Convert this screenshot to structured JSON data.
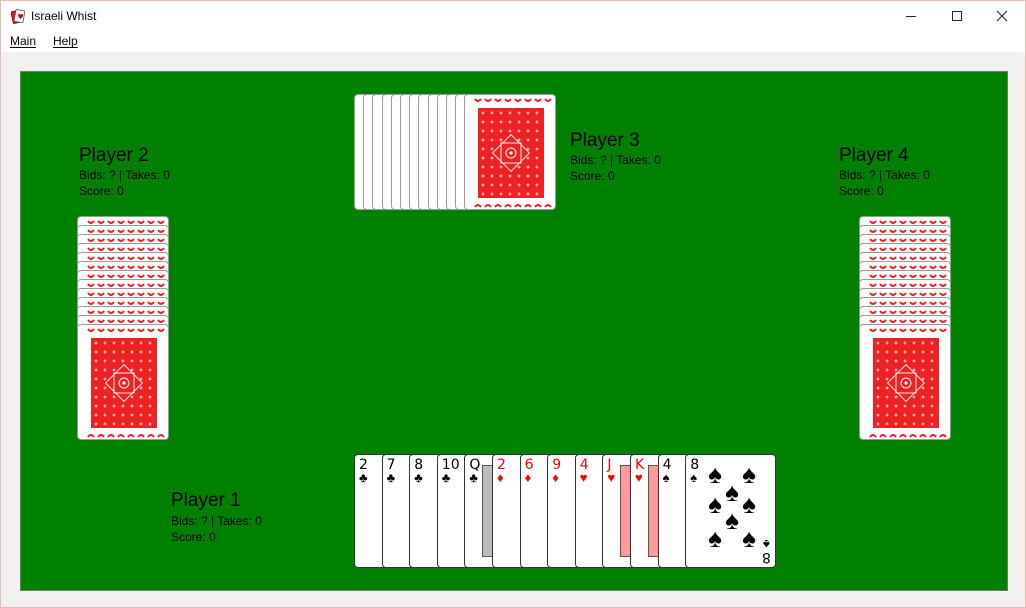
{
  "window": {
    "title": "Israeli Whist",
    "icons": {
      "app": "cards-app-icon",
      "minimize": "minimize-icon",
      "maximize": "maximize-icon",
      "close": "close-icon"
    }
  },
  "menu": {
    "main": "Main",
    "help": "Help"
  },
  "colors": {
    "table": "#008000",
    "card_back": "#ee2222",
    "red_suit": "#ff0000"
  },
  "players": {
    "p1": {
      "name": "Player 1",
      "bids_takes": "Bids: ? | Takes: 0",
      "score": "Score: 0"
    },
    "p2": {
      "name": "Player 2",
      "bids_takes": "Bids: ? | Takes: 0",
      "score": "Score: 0"
    },
    "p3": {
      "name": "Player 3",
      "bids_takes": "Bids: ? | Takes: 0",
      "score": "Score: 0"
    },
    "p4": {
      "name": "Player 4",
      "bids_takes": "Bids: ? | Takes: 0",
      "score": "Score: 0"
    }
  },
  "hand": [
    {
      "rank": "2",
      "suit": "♣",
      "color": "black"
    },
    {
      "rank": "7",
      "suit": "♣",
      "color": "black"
    },
    {
      "rank": "8",
      "suit": "♣",
      "color": "black"
    },
    {
      "rank": "10",
      "suit": "♣",
      "color": "black"
    },
    {
      "rank": "Q",
      "suit": "♣",
      "color": "black"
    },
    {
      "rank": "2",
      "suit": "♦",
      "color": "red"
    },
    {
      "rank": "6",
      "suit": "♦",
      "color": "red"
    },
    {
      "rank": "9",
      "suit": "♦",
      "color": "red"
    },
    {
      "rank": "4",
      "suit": "♥",
      "color": "red"
    },
    {
      "rank": "J",
      "suit": "♥",
      "color": "red"
    },
    {
      "rank": "K",
      "suit": "♥",
      "color": "red"
    },
    {
      "rank": "4",
      "suit": "♠",
      "color": "black"
    },
    {
      "rank": "8",
      "suit": "♠",
      "color": "black"
    }
  ],
  "opponent_card_count": 13
}
